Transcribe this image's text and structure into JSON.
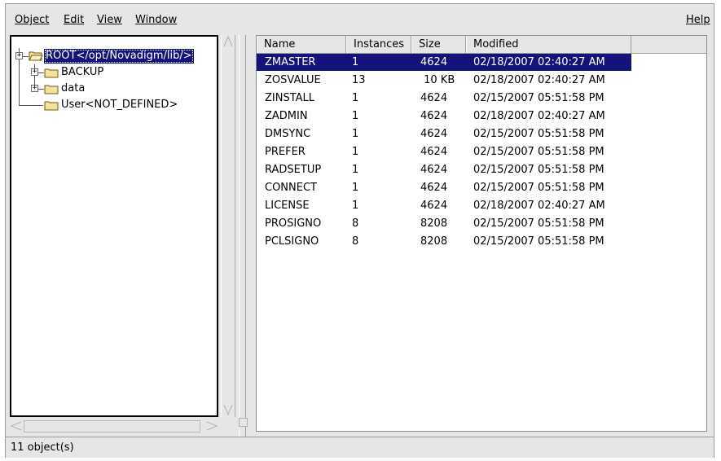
{
  "menu": {
    "object": "Object",
    "edit": "Edit",
    "view": "View",
    "window": "Window",
    "help": "Help"
  },
  "tree": {
    "items": [
      {
        "label": "ROOT</opt/Novadigm/lib/>",
        "expander": "+",
        "selected": true
      },
      {
        "label": "BACKUP",
        "expander": "+"
      },
      {
        "label": "data",
        "expander": "+"
      },
      {
        "label": "User<NOT_DEFINED>"
      }
    ]
  },
  "list": {
    "columns": [
      "Name",
      "Instances",
      "Size",
      "Modified"
    ],
    "rows": [
      {
        "name": "ZMASTER",
        "instances": "1",
        "size": "4624",
        "modified": "02/18/2007 02:40:27 AM",
        "selected": true
      },
      {
        "name": "ZOSVALUE",
        "instances": "13",
        "size": " 10 KB",
        "modified": "02/18/2007 02:40:27 AM"
      },
      {
        "name": "ZINSTALL",
        "instances": "1",
        "size": "4624",
        "modified": "02/15/2007 05:51:58 PM"
      },
      {
        "name": "ZADMIN",
        "instances": "1",
        "size": "4624",
        "modified": "02/18/2007 02:40:27 AM"
      },
      {
        "name": "DMSYNC",
        "instances": "1",
        "size": "4624",
        "modified": "02/15/2007 05:51:58 PM"
      },
      {
        "name": "PREFER",
        "instances": "1",
        "size": "4624",
        "modified": "02/15/2007 05:51:58 PM"
      },
      {
        "name": "RADSETUP",
        "instances": "1",
        "size": "4624",
        "modified": "02/15/2007 05:51:58 PM"
      },
      {
        "name": "CONNECT",
        "instances": "1",
        "size": "4624",
        "modified": "02/15/2007 05:51:58 PM"
      },
      {
        "name": "LICENSE",
        "instances": "1",
        "size": "4624",
        "modified": "02/18/2007 02:40:27 AM"
      },
      {
        "name": "PROSIGNO",
        "instances": "8",
        "size": "8208",
        "modified": "02/15/2007 05:51:58 PM"
      },
      {
        "name": "PCLSIGNO",
        "instances": "8",
        "size": "8208",
        "modified": "02/15/2007 05:51:58 PM"
      }
    ]
  },
  "status": {
    "text": "11 object(s)"
  },
  "colors": {
    "selection": "#13137a",
    "folder": "#f2e29a",
    "window_bg": "#e6e6e6"
  },
  "icons": {
    "folder": "folder-icon",
    "open_folder": "folder-open-icon",
    "expander": "expander-plus-icon"
  }
}
